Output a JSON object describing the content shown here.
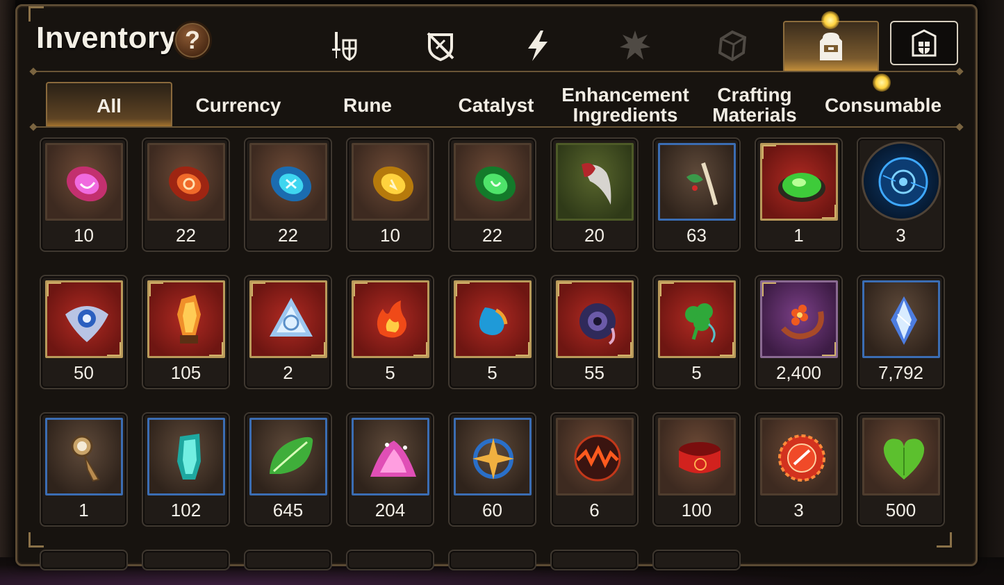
{
  "window": {
    "title": "Inventory",
    "help_label": "?"
  },
  "category_tabs": [
    {
      "name": "gear-icon",
      "active": false
    },
    {
      "name": "accessory-icon",
      "active": false
    },
    {
      "name": "skill-lightning-icon",
      "active": false
    },
    {
      "name": "artifact-icon",
      "active": false
    },
    {
      "name": "shard-box-icon",
      "active": false
    },
    {
      "name": "backpack-icon",
      "active": true
    },
    {
      "name": "guild-shield-icon",
      "active": false
    }
  ],
  "filter_tabs": [
    {
      "label": "All",
      "active": true
    },
    {
      "label": "Currency",
      "active": false
    },
    {
      "label": "Rune",
      "active": false
    },
    {
      "label": "Catalyst",
      "active": false
    },
    {
      "label": "Enhancement\nIngredients",
      "active": false
    },
    {
      "label": "Crafting\nMaterials",
      "active": false
    },
    {
      "label": "Consumable",
      "active": false,
      "notification": true
    }
  ],
  "items": [
    {
      "icon": "pink-gem-icon",
      "count": "10",
      "frame": "brown"
    },
    {
      "icon": "red-gem-icon",
      "count": "22",
      "frame": "brown"
    },
    {
      "icon": "cyan-gem-icon",
      "count": "22",
      "frame": "brown"
    },
    {
      "icon": "yellow-gem-icon",
      "count": "10",
      "frame": "brown"
    },
    {
      "icon": "green-gem-icon",
      "count": "22",
      "frame": "brown"
    },
    {
      "icon": "claw-icon",
      "count": "20",
      "frame": "green"
    },
    {
      "icon": "root-herb-icon",
      "count": "63",
      "frame": "blue"
    },
    {
      "icon": "green-orb-icon",
      "count": "1",
      "frame": "red"
    },
    {
      "icon": "blue-rune-disc-icon",
      "count": "3",
      "frame": "round"
    },
    {
      "icon": "eye-emblem-icon",
      "count": "50",
      "frame": "red"
    },
    {
      "icon": "fire-crystal-icon",
      "count": "105",
      "frame": "red"
    },
    {
      "icon": "triquetra-crystal-icon",
      "count": "2",
      "frame": "red"
    },
    {
      "icon": "fire-pendant-icon",
      "count": "5",
      "frame": "red"
    },
    {
      "icon": "water-pendant-icon",
      "count": "5",
      "frame": "red"
    },
    {
      "icon": "dark-ring-pendant-icon",
      "count": "55",
      "frame": "red"
    },
    {
      "icon": "clover-pendant-icon",
      "count": "5",
      "frame": "red"
    },
    {
      "icon": "flower-bracelet-icon",
      "count": "2,400",
      "frame": "purple"
    },
    {
      "icon": "blue-diamond-icon",
      "count": "7,792",
      "frame": "blue"
    },
    {
      "icon": "compass-key-icon",
      "count": "1",
      "frame": "blue"
    },
    {
      "icon": "teal-crystal-icon",
      "count": "102",
      "frame": "blue"
    },
    {
      "icon": "leaf-icon",
      "count": "645",
      "frame": "blue"
    },
    {
      "icon": "pink-powder-icon",
      "count": "204",
      "frame": "blue"
    },
    {
      "icon": "star-pendant-icon",
      "count": "60",
      "frame": "blue"
    },
    {
      "icon": "lava-orb-icon",
      "count": "6",
      "frame": "brown"
    },
    {
      "icon": "red-bracelet-icon",
      "count": "100",
      "frame": "brown"
    },
    {
      "icon": "red-seal-icon",
      "count": "3",
      "frame": "brown"
    },
    {
      "icon": "green-heart-icon",
      "count": "500",
      "frame": "brown"
    }
  ],
  "partial_row_count": 7,
  "colors": {
    "accent_gold": "#c28f3a",
    "notification": "#ffd23e"
  }
}
